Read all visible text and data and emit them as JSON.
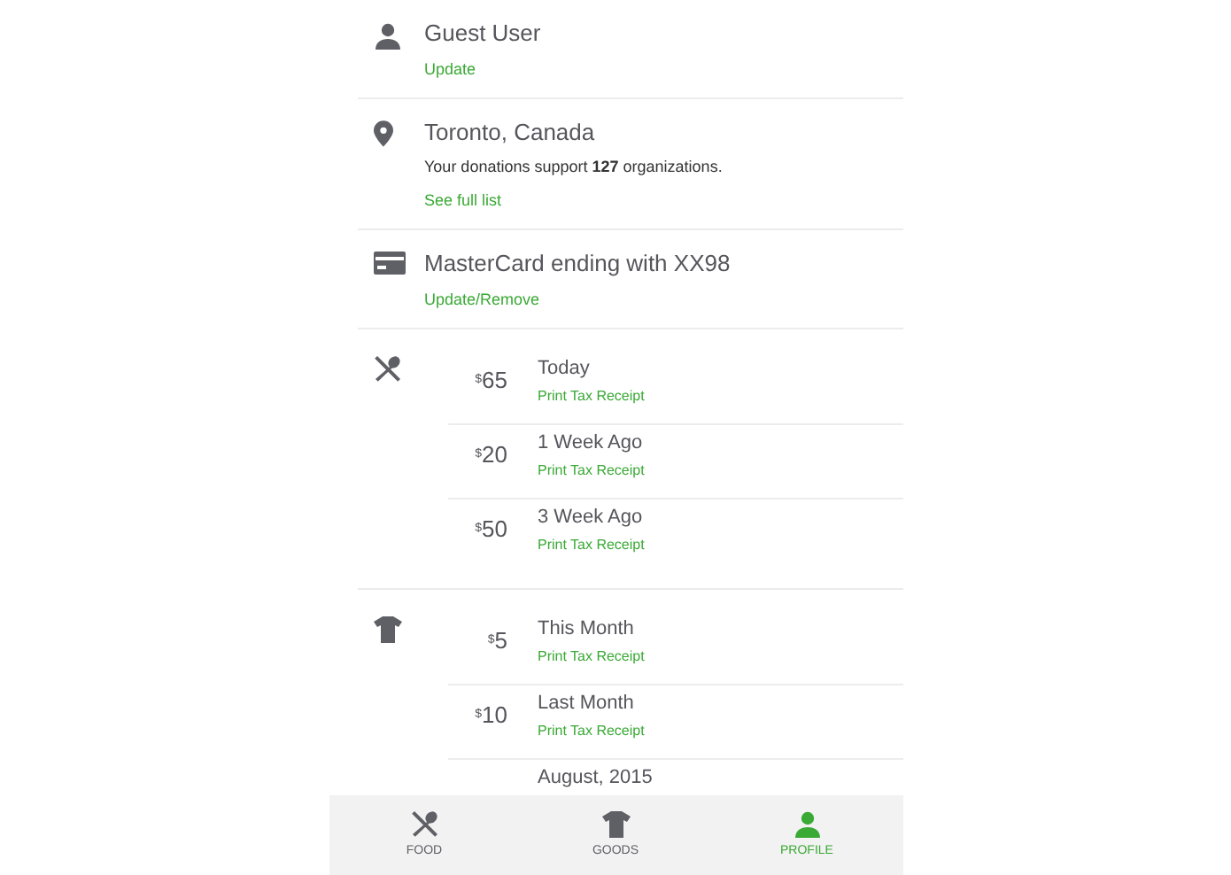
{
  "profile": {
    "name": "Guest User",
    "link": "Update"
  },
  "location": {
    "city": "Toronto, Canada",
    "summary": "Your donations support **127** organizations.",
    "link": "See full list"
  },
  "payment": {
    "card": "MasterCard ending with XX98",
    "link": "Update/Remove"
  },
  "donation_groups": [
    {
      "kind": "food",
      "entries": [
        {
          "currency": "$",
          "amount": "65",
          "when": "Today",
          "link": "Print Tax Receipt"
        },
        {
          "currency": "$",
          "amount": "20",
          "when": "1 Week Ago",
          "link": "Print Tax Receipt"
        },
        {
          "currency": "$",
          "amount": "50",
          "when": "3 Week Ago",
          "link": "Print Tax Receipt"
        }
      ]
    },
    {
      "kind": "goods",
      "entries": [
        {
          "currency": "$",
          "amount": "5",
          "when": "This Month",
          "link": "Print Tax Receipt"
        },
        {
          "currency": "$",
          "amount": "10",
          "when": "Last Month",
          "link": "Print Tax Receipt"
        },
        {
          "when": "August, 2015"
        }
      ]
    }
  ],
  "tab_bar": [
    {
      "kind": "food",
      "label": "FOOD",
      "selected": false
    },
    {
      "kind": "goods",
      "label": "GOODS",
      "selected": false
    },
    {
      "kind": "profile",
      "label": "PROFILE",
      "selected": true
    }
  ]
}
